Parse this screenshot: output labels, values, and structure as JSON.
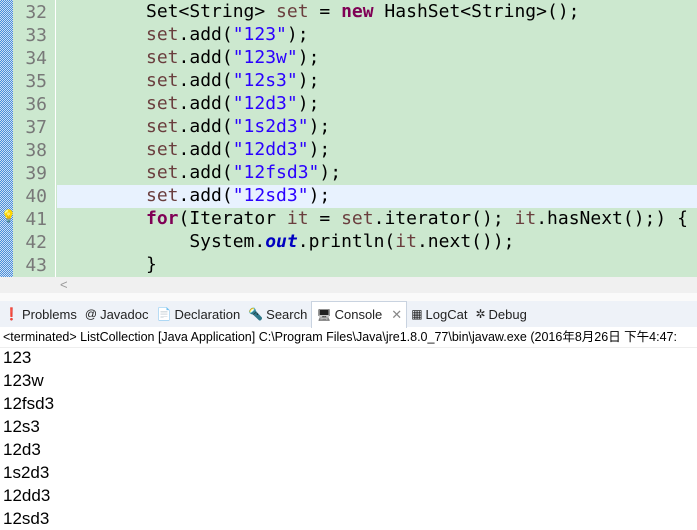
{
  "editor": {
    "line_numbers": [
      "32",
      "33",
      "34",
      "35",
      "36",
      "37",
      "38",
      "39",
      "40",
      "41",
      "42",
      "43"
    ],
    "lines": [
      "Set<String> set = new HashSet<String>();",
      "set.add(\"123\");",
      "set.add(\"123w\");",
      "set.add(\"12s3\");",
      "set.add(\"12d3\");",
      "set.add(\"1s2d3\");",
      "set.add(\"12dd3\");",
      "set.add(\"12fsd3\");",
      "set.add(\"12sd3\");",
      "for(Iterator it = set.iterator(); it.hasNext();) {",
      "    System.out.println(it.next());",
      "}"
    ],
    "current_line": "40"
  },
  "tabs": [
    {
      "label": "Problems",
      "icon": "problems-icon"
    },
    {
      "label": "Javadoc",
      "icon": "at-icon"
    },
    {
      "label": "Declaration",
      "icon": "declaration-icon"
    },
    {
      "label": "Search",
      "icon": "search-icon"
    },
    {
      "label": "Console",
      "icon": "console-icon",
      "active": true
    },
    {
      "label": "LogCat",
      "icon": "logcat-icon"
    },
    {
      "label": "Debug",
      "icon": "bug-icon"
    }
  ],
  "console": {
    "status": "<terminated> ListCollection [Java Application] C:\\Program Files\\Java\\jre1.8.0_77\\bin\\javaw.exe (2016年8月26日 下午4:47:",
    "output": [
      "123",
      "123w",
      "12fsd3",
      "12s3",
      "12d3",
      "1s2d3",
      "12dd3",
      "12sd3"
    ]
  }
}
